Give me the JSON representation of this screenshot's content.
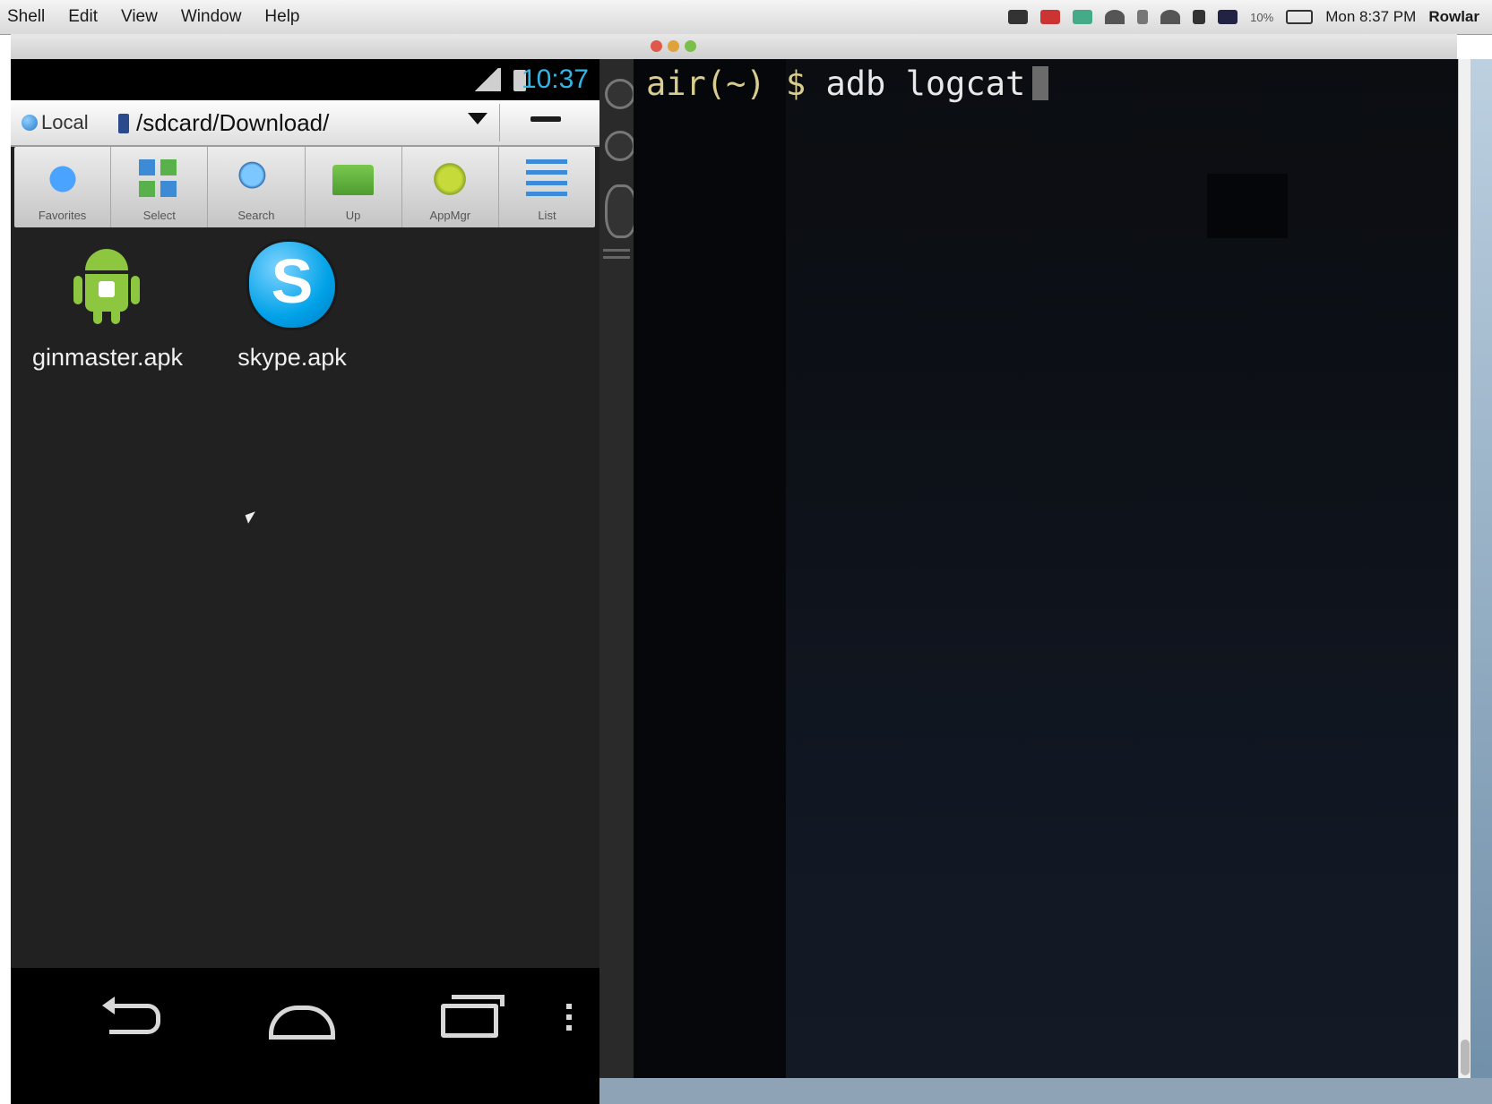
{
  "menubar": {
    "menus": [
      "Shell",
      "Edit",
      "View",
      "Window",
      "Help"
    ],
    "clock": "Mon 8:37 PM",
    "battery": "10%",
    "user": "Rowlar"
  },
  "android": {
    "status_time": "10:37",
    "location_label": "Local",
    "path": "/sdcard/Download/",
    "toolbar": [
      "Favorites",
      "Select",
      "Search",
      "Up",
      "AppMgr",
      "List"
    ],
    "files": [
      {
        "name": "ginmaster.apk",
        "icon": "android-icon"
      },
      {
        "name": "skype.apk",
        "icon": "skype-icon"
      }
    ]
  },
  "terminal": {
    "prompt": "air(~) $",
    "command": "adb logcat"
  },
  "colors": {
    "android_bg": "#212121",
    "status_time": "#33b5e5",
    "terminal_bg": "#0d1118",
    "prompt": "#d9cc8f"
  }
}
